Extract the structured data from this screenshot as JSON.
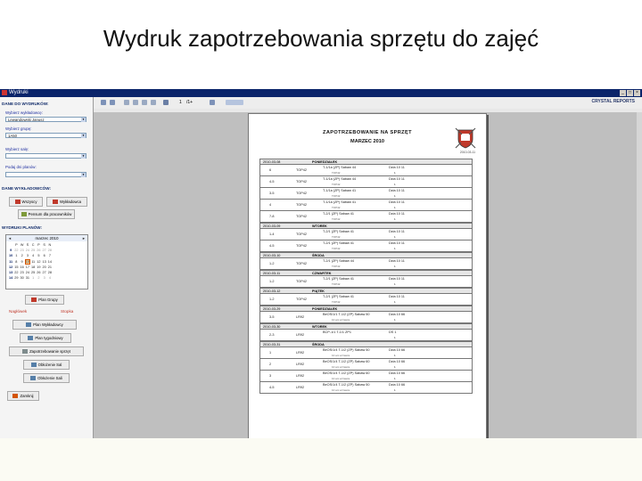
{
  "slide_title": "Wydruk zapotrzebowania sprzętu do zajęć",
  "window": {
    "title": "Wydruki",
    "controls": [
      "_",
      "□",
      "×"
    ]
  },
  "left": {
    "section1": "DANE DO WYDRUKÓW:",
    "fields": [
      {
        "label": "Wybierz wykładowcę:",
        "value": "Lewandowski Janusz"
      },
      {
        "label": "Wybierz grupę:",
        "value": "1A50"
      },
      {
        "label": "Wybierz salę:",
        "value": ""
      },
      {
        "label": "Podaj dni planów:",
        "value": ""
      }
    ],
    "section2": "DANE WYKŁADOWCÓW:",
    "btn_wszyscy": "Wszyscy",
    "btn_wykladowca": "Wykładowca",
    "btn_pensum": "Pensum dla pracowników",
    "section3": "WYDRUKI PLANÓW:",
    "calendar": {
      "month": "marzec 2010",
      "weekdays": [
        "",
        "P",
        "W",
        "Ś",
        "C",
        "P",
        "S",
        "N"
      ],
      "weeks": [
        [
          {
            "w": "9"
          },
          {
            "d": "22",
            "o": 1
          },
          {
            "d": "23",
            "o": 1
          },
          {
            "d": "24",
            "o": 1
          },
          {
            "d": "25",
            "o": 1
          },
          {
            "d": "26",
            "o": 1
          },
          {
            "d": "27",
            "o": 1
          },
          {
            "d": "28",
            "o": 1
          }
        ],
        [
          {
            "w": "10"
          },
          {
            "d": "1"
          },
          {
            "d": "2"
          },
          {
            "d": "3"
          },
          {
            "d": "4"
          },
          {
            "d": "5"
          },
          {
            "d": "6"
          },
          {
            "d": "7"
          }
        ],
        [
          {
            "w": "11"
          },
          {
            "d": "8"
          },
          {
            "d": "9"
          },
          {
            "d": "10",
            "s": 1
          },
          {
            "d": "11"
          },
          {
            "d": "12"
          },
          {
            "d": "13"
          },
          {
            "d": "14"
          }
        ],
        [
          {
            "w": "12"
          },
          {
            "d": "15"
          },
          {
            "d": "16"
          },
          {
            "d": "17"
          },
          {
            "d": "18"
          },
          {
            "d": "19"
          },
          {
            "d": "20"
          },
          {
            "d": "21"
          }
        ],
        [
          {
            "w": "13"
          },
          {
            "d": "22"
          },
          {
            "d": "23"
          },
          {
            "d": "24"
          },
          {
            "d": "25"
          },
          {
            "d": "26"
          },
          {
            "d": "27"
          },
          {
            "d": "28"
          }
        ],
        [
          {
            "w": "14"
          },
          {
            "d": "29"
          },
          {
            "d": "30"
          },
          {
            "d": "31"
          },
          {
            "d": "1",
            "o": 1
          },
          {
            "d": "2",
            "o": 1
          },
          {
            "d": "3",
            "o": 1
          },
          {
            "d": "4",
            "o": 1
          }
        ]
      ]
    },
    "btn_plan_grupy": "Plan Grupy",
    "link_naglowek": "Nagłówek",
    "link_stopka": "Stopka",
    "btn_plan_wykladowcy": "Plan Wykładowcy",
    "btn_plan_tygodniowy": "Plan tygodniowy",
    "btn_zapotrzebowanie": "Zapotrzebowanie sprzęt",
    "btn_oblozenie_sal": "Obłożenie Sal",
    "btn_oblozenie_sali": "Obłożenie Sali",
    "btn_zamknij": "Zamknij"
  },
  "toolbar": {
    "page": "1",
    "page_of": "/1+",
    "brand": "CRYSTAL REPORTS"
  },
  "report": {
    "title": "ZAPOTRZEBOWANIE NA SPRZĘT",
    "subtitle": "MARZEC 2010",
    "printed": "2010-03-11",
    "days": [
      {
        "date": "2010-03-08",
        "name": "PONIEDZIAŁEK",
        "items": [
          {
            "t": "6",
            "r": "TOP42",
            "w": "T-1/1a (ZP) Sabaw 44",
            "s": "TOP42",
            "c": "Dzia 10 11",
            "q": "1"
          },
          {
            "t": "4-5",
            "r": "TOP42",
            "w": "T-1/1a (ZP) Sabaw 44",
            "s": "TOP42",
            "c": "Dzia 10 11",
            "q": "1"
          },
          {
            "t": "3-5",
            "r": "TOP42",
            "w": "T-1/1a (ZP) Sabaw 41",
            "s": "TOP42",
            "c": "Dzia 10 11",
            "q": "1"
          },
          {
            "t": "4",
            "r": "TOP42",
            "w": "T-1/1a (ZP) Sabaw 41",
            "s": "TOP42",
            "c": "Dzia 10 11",
            "q": "1"
          },
          {
            "t": "7-8",
            "r": "TOP42",
            "w": "T-2/1 (ZP) Sabaw 41",
            "s": "TOP42",
            "c": "Dzia 10 11",
            "q": "1"
          }
        ]
      },
      {
        "date": "2010-03-09",
        "name": "WTOREK",
        "items": [
          {
            "t": "1-4",
            "r": "TOP42",
            "w": "T-2/1 (ZP) Sabaw 41",
            "s": "TOP42",
            "c": "Dzia 10 11",
            "q": "1"
          },
          {
            "t": "4-5",
            "r": "TOP42",
            "w": "T-2/1 (ZP) Sabaw 41",
            "s": "TOP42",
            "c": "Dzia 10 11",
            "q": "1"
          }
        ]
      },
      {
        "date": "2010-03-10",
        "name": "ŚRODA",
        "items": [
          {
            "t": "1-2",
            "r": "TOP42",
            "w": "T-2/1 (ZP) Sabaw 44",
            "s": "TOP42",
            "c": "Dzia 10 11",
            "q": "1"
          }
        ]
      },
      {
        "date": "2010-03-11",
        "name": "CZWARTEK",
        "items": [
          {
            "t": "1-2",
            "r": "TOP42",
            "w": "T-2/1 (ZP) Sabaw 41",
            "s": "TOP42",
            "c": "Dzia 10 11",
            "q": "1"
          }
        ]
      },
      {
        "date": "2010-03-12",
        "name": "PIĄTEK",
        "items": [
          {
            "t": "1-2",
            "r": "TOP42",
            "w": "T-2/1 (ZP) Sabaw 41",
            "s": "TOP42",
            "c": "Dzia 10 11",
            "q": "1"
          }
        ]
      },
      {
        "date": "2010-03-29",
        "name": "PONIEDZIAŁEK",
        "items": [
          {
            "t": "3-5",
            "r": "LR92",
            "w": "BeOS/1/1 T-1/2 (ZP) Sabaw 50",
            "s": "10 arc wzrasza",
            "c": "Dzia 10 66",
            "q": "1"
          }
        ]
      },
      {
        "date": "2010-03-30",
        "name": "WTOREK",
        "items": [
          {
            "t": "2-3",
            "r": "LR92",
            "w": "BCP-1/1 T-1/1 ZP1",
            "s": "",
            "c": "DS 1",
            "q": "1"
          }
        ]
      },
      {
        "date": "2010-03-31",
        "name": "ŚRODA",
        "items": [
          {
            "t": "1",
            "r": "LR92",
            "w": "BeOS/1/4 T-1/2 (ZP) Sabaw 50",
            "s": "10 arc wzrasza",
            "c": "Dzia 10 66",
            "q": "1"
          },
          {
            "t": "2",
            "r": "LR92",
            "w": "BeOS/1/4 T-1/2 (ZP) Sabaw 60",
            "s": "10 arc wzrasza",
            "c": "Dzia 10 66",
            "q": "1"
          },
          {
            "t": "3",
            "r": "LR92",
            "w": "BeOS/1/4 T-1/2 (ZP) Sabaw 60",
            "s": "10 arc wzrasza",
            "c": "Dzia 10 66",
            "q": "1"
          },
          {
            "t": "4-5",
            "r": "LR92",
            "w": "BeOS/1/4 T-1/2 (ZP) Sabaw 50",
            "s": "10 arc wzrasza",
            "c": "Dzia 10 66",
            "q": "1"
          }
        ]
      }
    ]
  }
}
